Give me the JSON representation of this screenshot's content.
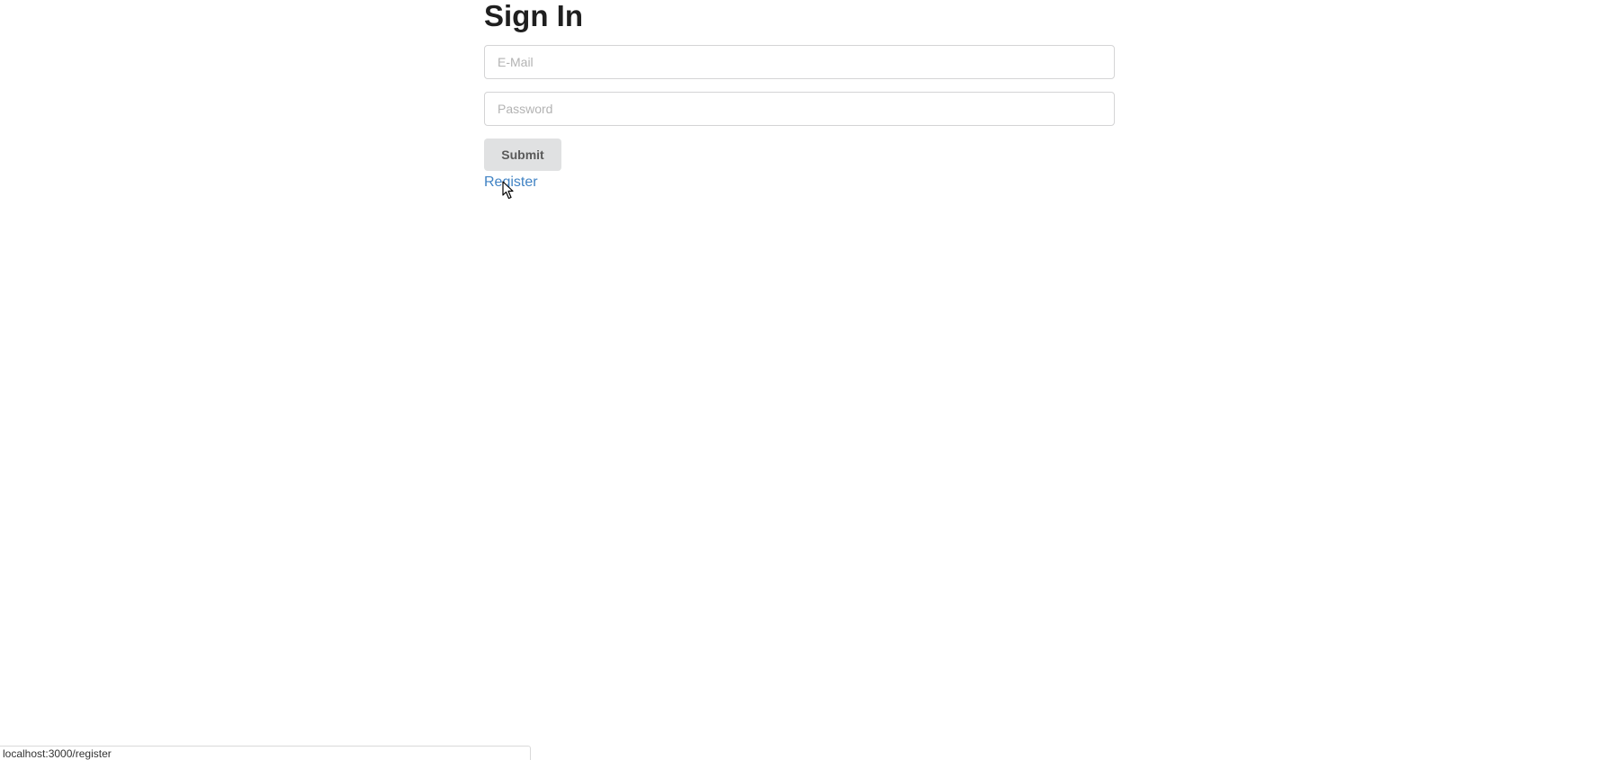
{
  "form": {
    "title": "Sign In",
    "email_placeholder": "E-Mail",
    "password_placeholder": "Password",
    "submit_label": "Submit",
    "register_label": "Register"
  },
  "status_bar": {
    "url": "localhost:3000/register"
  },
  "colors": {
    "link": "#4183c4",
    "button_bg": "#e0e1e2",
    "title": "#1f1f1f"
  }
}
